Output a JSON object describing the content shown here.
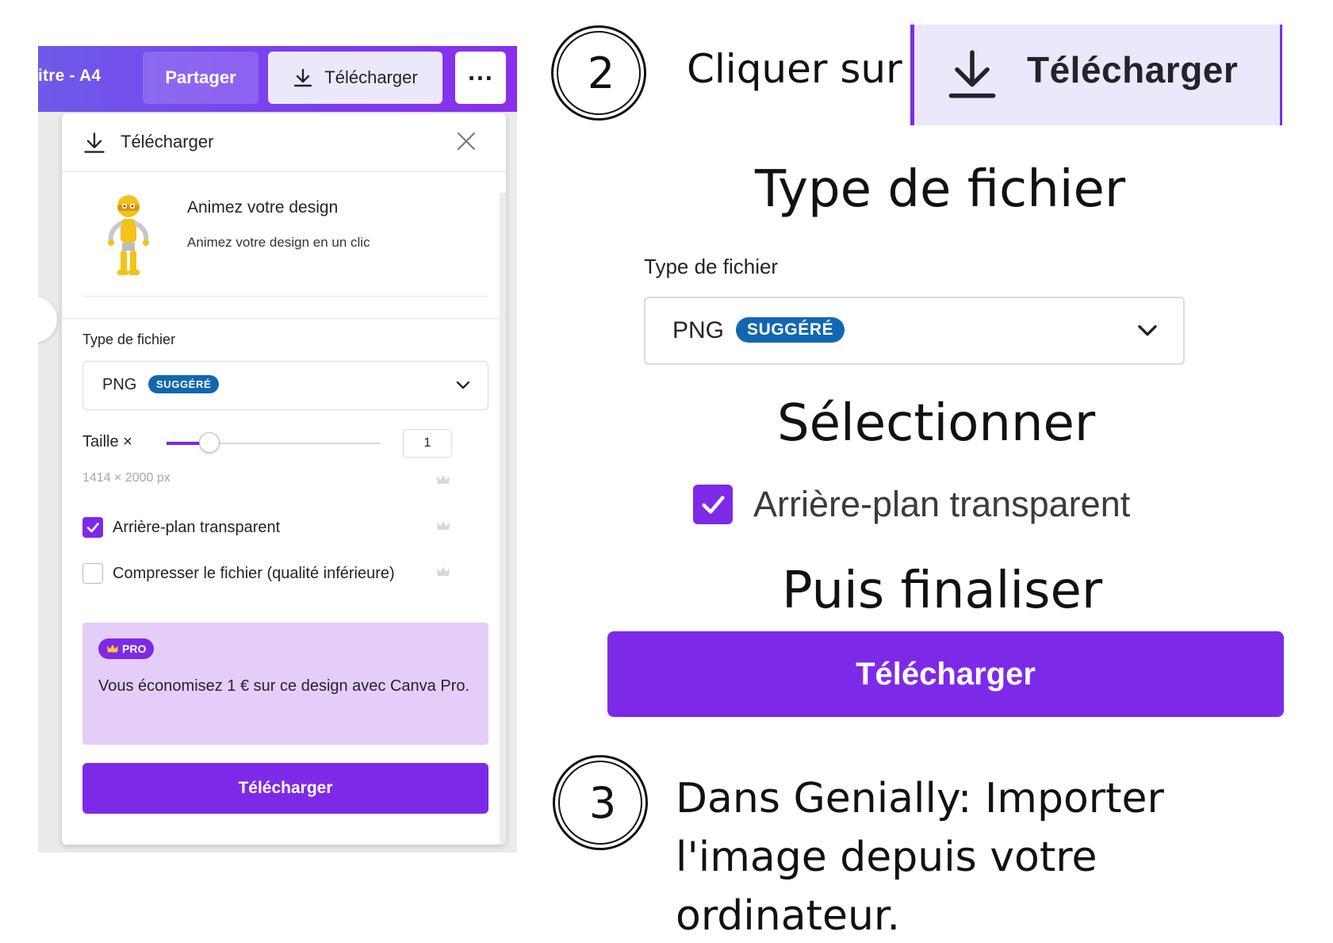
{
  "left_screenshot": {
    "doc_title": "itre - A4",
    "share_label": "Partager",
    "download_label": "Télécharger",
    "more_label": "...",
    "panel": {
      "title": "Télécharger",
      "animate": {
        "title": "Animez votre design",
        "subtitle": "Animez votre design en un clic"
      },
      "file_type_label": "Type de fichier",
      "file_type_value": "PNG",
      "suggested_badge": "SUGGÉRÉ",
      "size_label": "Taille ×",
      "size_value": "1",
      "size_slider_fraction": 0.2,
      "dimensions": "1414 × 2000 px",
      "transparent_bg_label": "Arrière-plan transparent",
      "transparent_bg_checked": true,
      "compress_label": "Compresser le fichier (qualité inférieure)",
      "compress_checked": false,
      "pro_badge": "PRO",
      "pro_text": "Vous économisez 1 € sur ce design avec Canva Pro.",
      "download_button": "Télécharger"
    }
  },
  "instructions": {
    "step2_number": "2",
    "click_on": "Cliquer sur",
    "big_download_label": "Télécharger",
    "heading_file_type": "Type de fichier",
    "zoom_file_type_label": "Type de fichier",
    "zoom_file_type_value": "PNG",
    "zoom_suggested_badge": "SUGGÉRÉ",
    "heading_select": "Sélectionner",
    "zoom_transparent_label": "Arrière-plan transparent",
    "heading_finish": "Puis finaliser",
    "zoom_download_button": "Télécharger",
    "step3_number": "3",
    "step3_text": "Dans Genially: Importer l'image depuis votre ordinateur."
  },
  "colors": {
    "brand_purple": "#7d2ae8",
    "badge_blue": "#1167b1",
    "pro_background": "#e5cdfa",
    "download_light": "#ece8fb"
  },
  "icons": [
    "download-icon",
    "close-icon",
    "chevron-down-icon",
    "crown-icon",
    "check-icon",
    "more-icon"
  ]
}
